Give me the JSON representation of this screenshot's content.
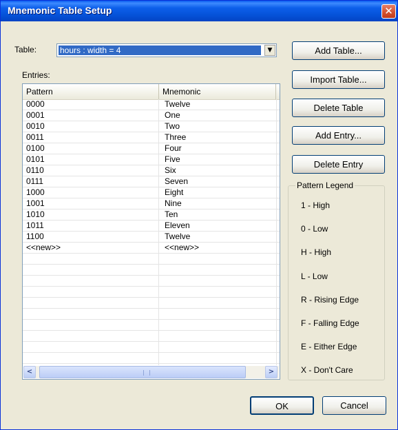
{
  "window": {
    "title": "Mnemonic Table Setup",
    "close_glyph": "✕"
  },
  "table_select": {
    "label": "Table:",
    "value": "hours : width = 4"
  },
  "entries": {
    "label": "Entries:",
    "columns": [
      "Pattern",
      "Mnemonic"
    ],
    "rows": [
      [
        "0000",
        "Twelve"
      ],
      [
        "0001",
        "One"
      ],
      [
        "0010",
        "Two"
      ],
      [
        "0011",
        "Three"
      ],
      [
        "0100",
        "Four"
      ],
      [
        "0101",
        "Five"
      ],
      [
        "0110",
        "Six"
      ],
      [
        "0111",
        "Seven"
      ],
      [
        "1000",
        "Eight"
      ],
      [
        "1001",
        "Nine"
      ],
      [
        "1010",
        "Ten"
      ],
      [
        "1011",
        "Eleven"
      ],
      [
        "1100",
        "Twelve"
      ],
      [
        "<<new>>",
        "<<new>>"
      ]
    ]
  },
  "buttons": {
    "add_table": "Add Table...",
    "import_table": "Import Table...",
    "delete_table": "Delete Table",
    "add_entry": "Add Entry...",
    "delete_entry": "Delete Entry",
    "ok": "OK",
    "cancel": "Cancel"
  },
  "legend": {
    "title": "Pattern Legend",
    "items": [
      "1 - High",
      "0 - Low",
      "H - High",
      "L - Low",
      "R - Rising Edge",
      "F - Falling Edge",
      "E - Either Edge",
      "X - Don't Care"
    ]
  },
  "colors": {
    "titlebar": "#0a5bf0",
    "selection": "#316ac5",
    "dialog_bg": "#ece9d8"
  }
}
